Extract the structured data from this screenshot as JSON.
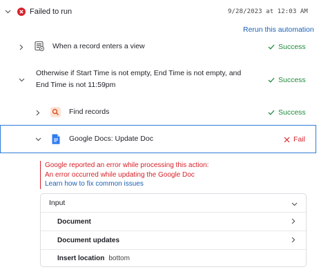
{
  "run": {
    "status": "Failed to run",
    "timestamp": "9/28/2023 at 12:03 AM",
    "rerun_label": "Rerun this automation"
  },
  "steps": {
    "trigger": {
      "label": "When a record enters a view",
      "status": "Success"
    },
    "condition": {
      "line1": "Otherwise if Start Time is not empty, End Time is not empty, and",
      "line2": "End Time is not 11:59pm",
      "status": "Success"
    },
    "find": {
      "label": "Find records",
      "status": "Success"
    },
    "gdocs": {
      "label": "Google Docs: Update Doc",
      "status": "Fail"
    }
  },
  "error": {
    "line1": "Google reported an error while processing this action:",
    "line2": "An error occurred while updating the Google Doc",
    "link": "Learn how to fix common issues"
  },
  "input_panel": {
    "title": "Input",
    "document": "Document",
    "document_updates": "Document updates",
    "insert_location_label": "Insert location",
    "insert_location_value": "bottom"
  },
  "colors": {
    "success": "#1f8a3b",
    "fail": "#d6212a",
    "link": "#1a5fb4",
    "selected_border": "#2f7bd6"
  }
}
